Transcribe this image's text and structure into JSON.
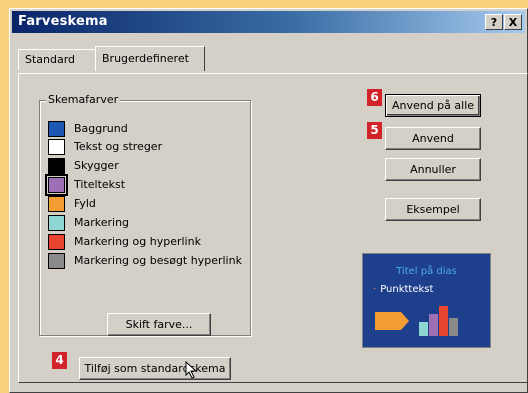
{
  "window": {
    "title": "Farveskema",
    "help_button": "?",
    "close_button": "X"
  },
  "tabs": [
    {
      "label": "Standard",
      "active": false
    },
    {
      "label": "Brugerdefineret",
      "active": true
    }
  ],
  "scheme_group": {
    "legend": "Skemafarver",
    "items": [
      {
        "label": "Baggrund",
        "color": "#1B57B3"
      },
      {
        "label": "Tekst og streger",
        "color": "#FFFFFF"
      },
      {
        "label": "Skygger",
        "color": "#000000"
      },
      {
        "label": "Titeltekst",
        "color": "#9E6FB5",
        "selected": true
      },
      {
        "label": "Fyld",
        "color": "#F39C33"
      },
      {
        "label": "Markering",
        "color": "#8ED6D3"
      },
      {
        "label": "Markering og hyperlink",
        "color": "#E8442F"
      },
      {
        "label": "Markering og besøgt hyperlink",
        "color": "#8A8A8A"
      }
    ],
    "change_color_button": "Skift farve..."
  },
  "buttons": {
    "apply_all": "Anvend på alle",
    "apply": "Anvend",
    "cancel": "Annuller",
    "preview": "Eksempel",
    "add_standard": "Tilføj som standardskema"
  },
  "markers": {
    "apply_all": "6",
    "apply": "5",
    "add_standard": "4"
  },
  "preview": {
    "title": "Titel på dias",
    "bullet": "Punkttekst"
  },
  "colors": {
    "page_bg": "#F8D27A",
    "dialog_bg": "#D4D0C8",
    "titlebar_start": "#0A246A",
    "marker_red": "#D2232A",
    "preview_bg": "#1E3F8C"
  }
}
